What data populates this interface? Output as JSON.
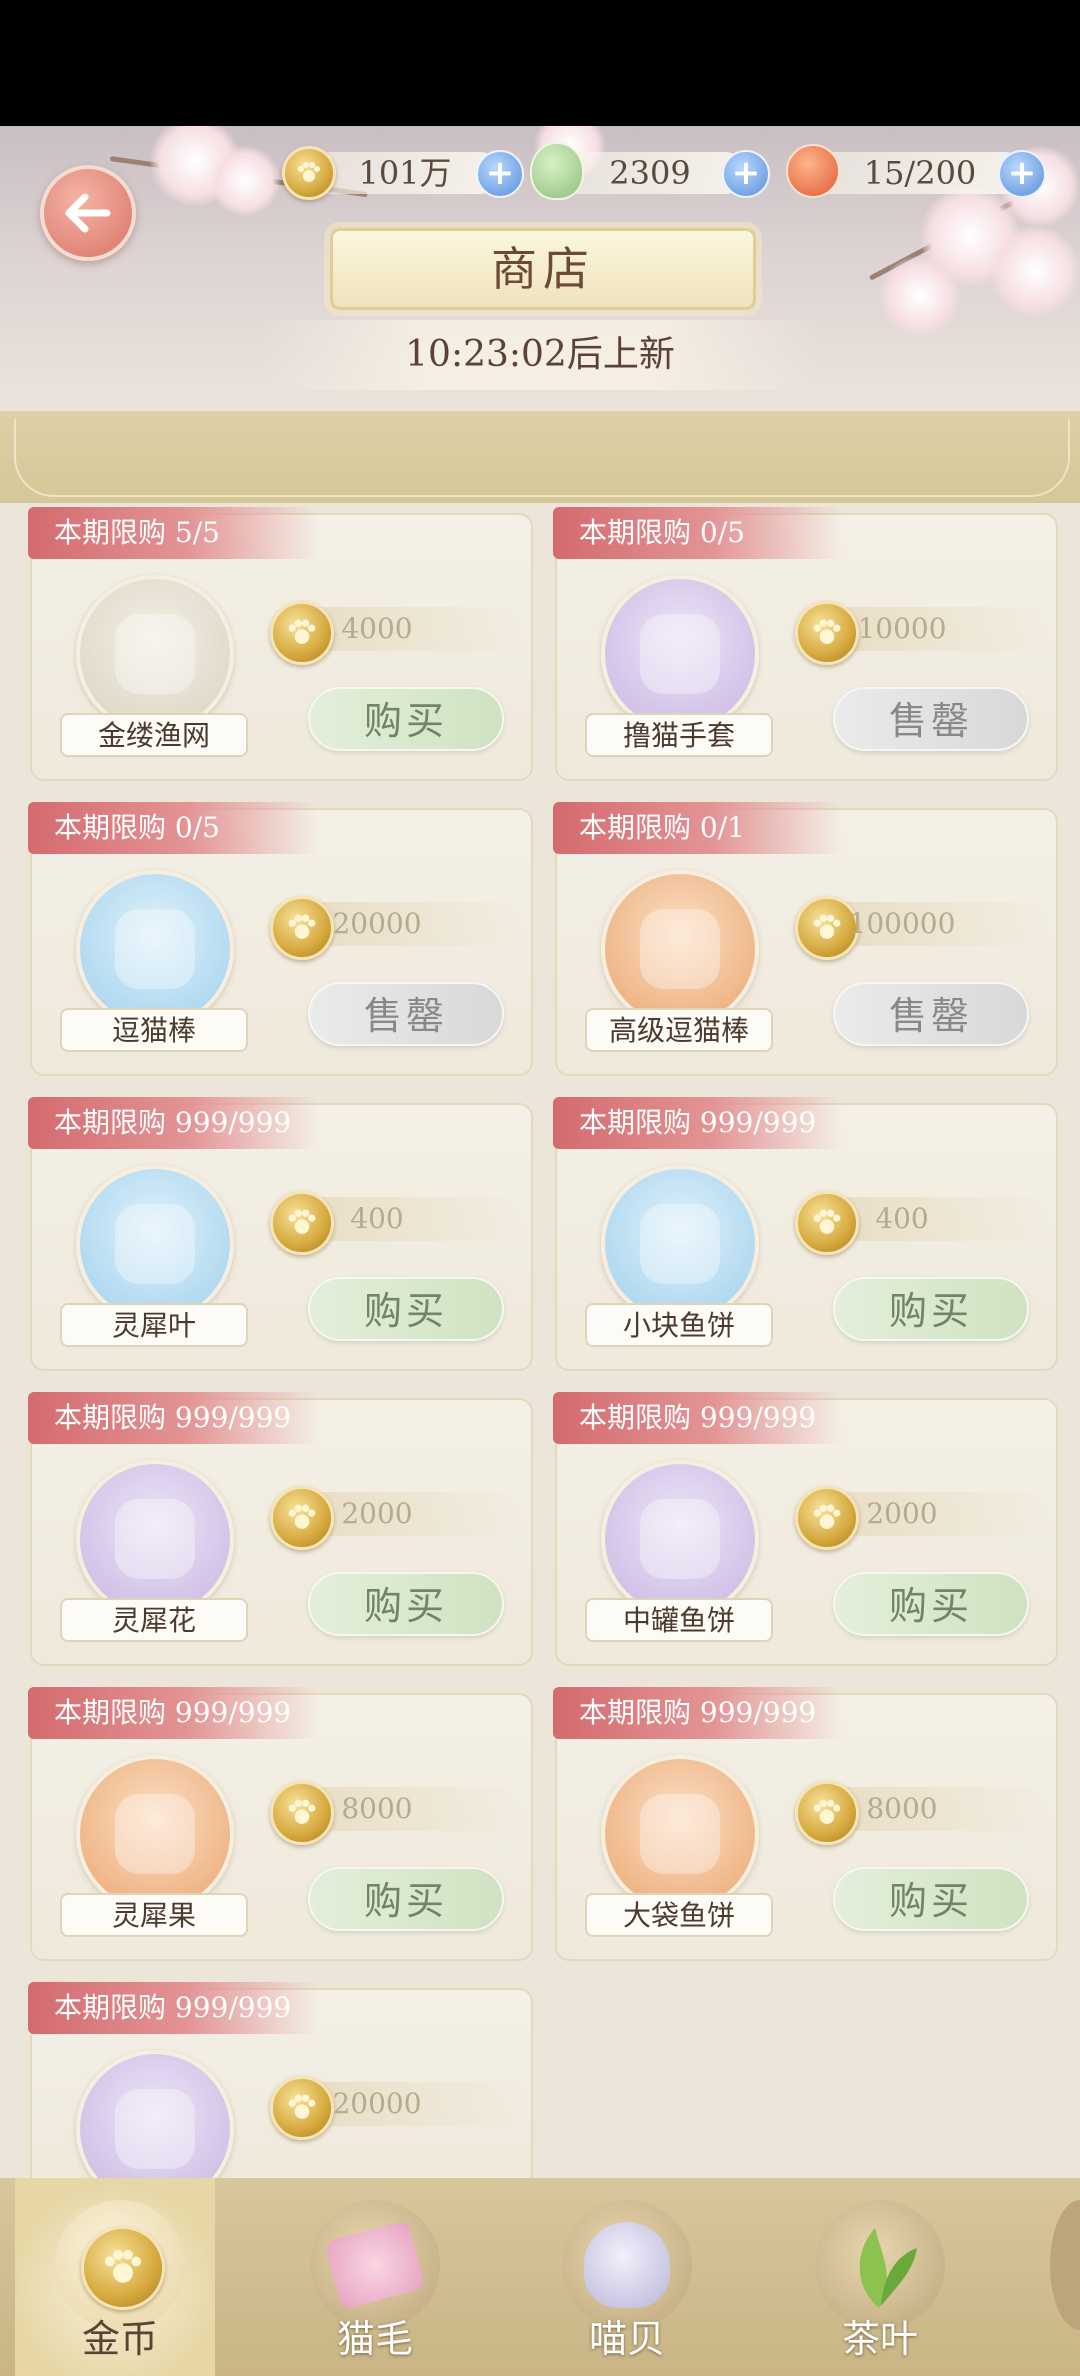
{
  "header": {
    "resources": [
      {
        "icon": "paw-coin-icon",
        "value": "101万"
      },
      {
        "icon": "green-gem-icon",
        "value": "2309"
      },
      {
        "icon": "energy-peach-icon",
        "value": "15/200"
      }
    ],
    "title": "商店",
    "refresh_timer": "10:23:02后上新"
  },
  "items": [
    {
      "limit": "本期限购 5/5",
      "name": "金缕渔网",
      "price": "4000",
      "button": "购买",
      "status": "buy",
      "icon": "fishing-net-icon"
    },
    {
      "limit": "本期限购 0/5",
      "name": "撸猫手套",
      "price": "10000",
      "button": "售罄",
      "status": "sold",
      "icon": "cat-glove-icon"
    },
    {
      "limit": "本期限购 0/5",
      "name": "逗猫棒",
      "price": "20000",
      "button": "售罄",
      "status": "sold",
      "icon": "cat-wand-icon"
    },
    {
      "limit": "本期限购 0/1",
      "name": "高级逗猫棒",
      "price": "100000",
      "button": "售罄",
      "status": "sold",
      "icon": "premium-cat-wand-icon"
    },
    {
      "limit": "本期限购 999/999",
      "name": "灵犀叶",
      "price": "400",
      "button": "购买",
      "status": "buy",
      "icon": "gold-leaf-icon"
    },
    {
      "limit": "本期限购 999/999",
      "name": "小块鱼饼",
      "price": "400",
      "button": "购买",
      "status": "buy",
      "icon": "fish-cake-icon"
    },
    {
      "limit": "本期限购 999/999",
      "name": "灵犀花",
      "price": "2000",
      "button": "购买",
      "status": "buy",
      "icon": "gold-flower-icon"
    },
    {
      "limit": "本期限购 999/999",
      "name": "中罐鱼饼",
      "price": "2000",
      "button": "购买",
      "status": "buy",
      "icon": "fish-can-icon"
    },
    {
      "limit": "本期限购 999/999",
      "name": "灵犀果",
      "price": "8000",
      "button": "购买",
      "status": "buy",
      "icon": "gold-fruit-icon"
    },
    {
      "limit": "本期限购 999/999",
      "name": "大袋鱼饼",
      "price": "8000",
      "button": "购买",
      "status": "buy",
      "icon": "fish-bag-icon"
    },
    {
      "limit": "本期限购 999/999",
      "name": "",
      "price": "20000",
      "button": "",
      "status": "buy",
      "icon": "straw-hat-icon"
    }
  ],
  "nav": {
    "tabs": [
      {
        "label": "金币",
        "icon": "paw-coin-icon",
        "active": true
      },
      {
        "label": "猫毛",
        "icon": "cat-fur-icon",
        "active": false
      },
      {
        "label": "喵贝",
        "icon": "cat-shell-icon",
        "active": false
      },
      {
        "label": "茶叶",
        "icon": "tea-leaf-icon",
        "active": false
      }
    ]
  }
}
